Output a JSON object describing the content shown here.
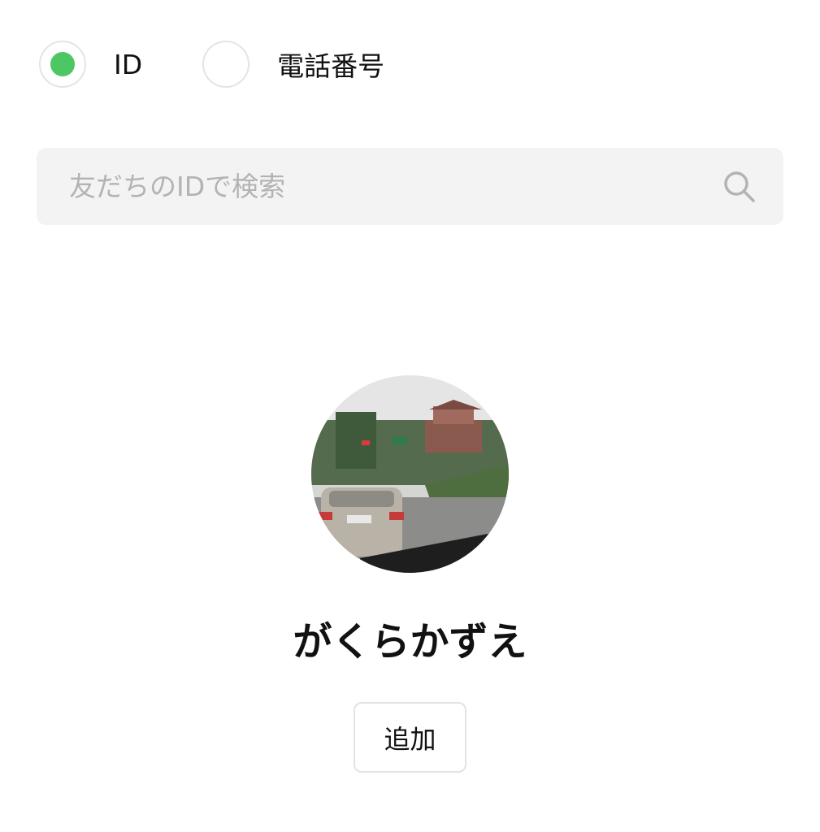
{
  "search_mode": {
    "options": [
      {
        "label": "ID",
        "selected": true
      },
      {
        "label": "電話番号",
        "selected": false
      }
    ],
    "selected_color": "#4cc764"
  },
  "search": {
    "placeholder": "友だちのIDで検索",
    "value": "",
    "icon": "search-icon"
  },
  "profile": {
    "avatar_icon": "profile-photo",
    "name": "がくらかずえ",
    "add_label": "追加"
  }
}
